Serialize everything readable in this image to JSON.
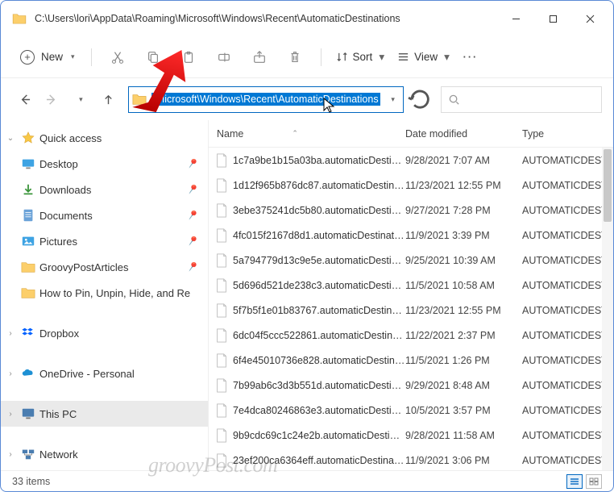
{
  "window": {
    "title": "C:\\Users\\lori\\AppData\\Roaming\\Microsoft\\Windows\\Recent\\AutomaticDestinations"
  },
  "toolbar": {
    "new_label": "New",
    "sort_label": "Sort",
    "view_label": "View"
  },
  "address": {
    "path": "\\Microsoft\\Windows\\Recent\\AutomaticDestinations"
  },
  "search": {
    "placeholder": ""
  },
  "sidebar": {
    "quick_access": "Quick access",
    "items": [
      {
        "label": "Desktop"
      },
      {
        "label": "Downloads"
      },
      {
        "label": "Documents"
      },
      {
        "label": "Pictures"
      },
      {
        "label": "GroovyPostArticles"
      },
      {
        "label": "How to Pin, Unpin, Hide, and Re"
      }
    ],
    "dropbox": "Dropbox",
    "onedrive": "OneDrive - Personal",
    "thispc": "This PC",
    "network": "Network"
  },
  "columns": {
    "name": "Name",
    "date": "Date modified",
    "type": "Type"
  },
  "files": [
    {
      "name": "1c7a9be1b15a03ba.automaticDestination..",
      "date": "9/28/2021 7:07 AM",
      "type": "AUTOMATICDEST"
    },
    {
      "name": "1d12f965b876dc87.automaticDestination..",
      "date": "11/23/2021 12:55 PM",
      "type": "AUTOMATICDEST"
    },
    {
      "name": "3ebe375241dc5b80.automaticDestination..",
      "date": "9/27/2021 7:28 PM",
      "type": "AUTOMATICDEST"
    },
    {
      "name": "4fc015f2167d8d1.automaticDestinations-..",
      "date": "11/9/2021 3:39 PM",
      "type": "AUTOMATICDEST"
    },
    {
      "name": "5a794779d13c9e5e.automaticDestination..",
      "date": "9/25/2021 10:39 AM",
      "type": "AUTOMATICDEST"
    },
    {
      "name": "5d696d521de238c3.automaticDestination..",
      "date": "11/5/2021 10:58 AM",
      "type": "AUTOMATICDEST"
    },
    {
      "name": "5f7b5f1e01b83767.automaticDestinations..",
      "date": "11/23/2021 12:55 PM",
      "type": "AUTOMATICDEST"
    },
    {
      "name": "6dc04f5ccc522861.automaticDestination..",
      "date": "11/22/2021 2:37 PM",
      "type": "AUTOMATICDEST"
    },
    {
      "name": "6f4e45010736e828.automaticDestination..",
      "date": "11/5/2021 1:26 PM",
      "type": "AUTOMATICDEST"
    },
    {
      "name": "7b99ab6c3d3b551d.automaticDestination..",
      "date": "9/29/2021 8:48 AM",
      "type": "AUTOMATICDEST"
    },
    {
      "name": "7e4dca80246863e3.automaticDestination..",
      "date": "10/5/2021 3:57 PM",
      "type": "AUTOMATICDEST"
    },
    {
      "name": "9b9cdc69c1c24e2b.automaticDestination..",
      "date": "9/28/2021 11:58 AM",
      "type": "AUTOMATICDEST"
    },
    {
      "name": "23ef200ca6364eff.automaticDestinations-..",
      "date": "11/9/2021 3:06 PM",
      "type": "AUTOMATICDEST"
    }
  ],
  "status": {
    "items": "33 items"
  },
  "watermark": "groovyPost.com"
}
